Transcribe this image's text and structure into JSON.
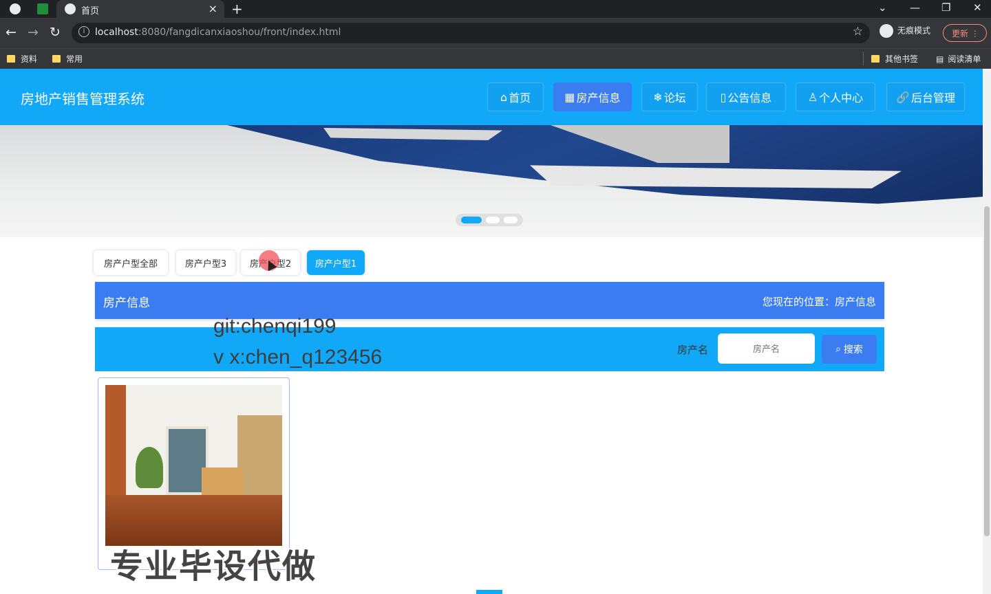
{
  "browser": {
    "tab_title": "首页",
    "url_host": "localhost",
    "url_rest": ":8080/fangdicanxiaoshou/front/index.html",
    "incognito_label": "无痕模式",
    "update_label": "更新",
    "bookmarks": [
      "资料",
      "常用"
    ],
    "bookmarks_right": [
      "其他书签",
      "阅读清单"
    ]
  },
  "header": {
    "title": "房地产销售管理系统",
    "menu": [
      {
        "icon": "⌂",
        "label": "首页"
      },
      {
        "icon": "▦",
        "label": "房产信息"
      },
      {
        "icon": "❄",
        "label": "论坛"
      },
      {
        "icon": "▯",
        "label": "公告信息"
      },
      {
        "icon": "♙",
        "label": "个人中心"
      },
      {
        "icon": "🔗",
        "label": "后台管理"
      }
    ]
  },
  "filters": [
    "房产户型全部",
    "房产户型3",
    "房产户型2",
    "房产户型1"
  ],
  "position": {
    "title": "房产信息",
    "location": "您现在的位置：房产信息"
  },
  "search": {
    "label": "房产名",
    "placeholder": "房产名",
    "button": "搜索"
  },
  "watermark": {
    "line1": "git:chenqi199",
    "line2": "v x:chen_q123456",
    "big": "专业毕设代做"
  }
}
